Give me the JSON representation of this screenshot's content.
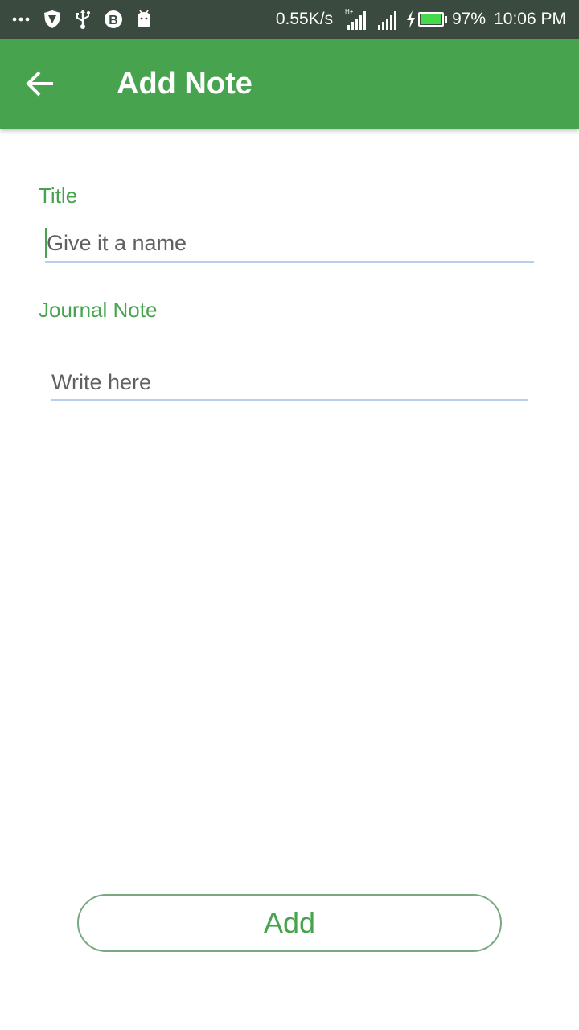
{
  "status_bar": {
    "speed": "0.55K/s",
    "network_type": "H+",
    "battery": "97%",
    "battery_level": 0.97,
    "time": "10:06 PM",
    "icons": [
      "more-dots-icon",
      "shield-icon",
      "usb-icon",
      "b-app-icon",
      "android-icon",
      "signal-icon",
      "charging-icon",
      "battery-icon"
    ]
  },
  "app_bar": {
    "title": "Add Note",
    "back_icon": "arrow-back-icon",
    "color": "#47a34e"
  },
  "form": {
    "title_label": "Title",
    "title_placeholder": "Give it a name",
    "title_value": "",
    "journal_label": "Journal Note",
    "journal_placeholder": "Write here",
    "journal_value": ""
  },
  "actions": {
    "add_label": "Add"
  },
  "colors": {
    "accent": "#47a34e",
    "status_bar": "#3b4a3e",
    "underline": "#b9cdec"
  }
}
